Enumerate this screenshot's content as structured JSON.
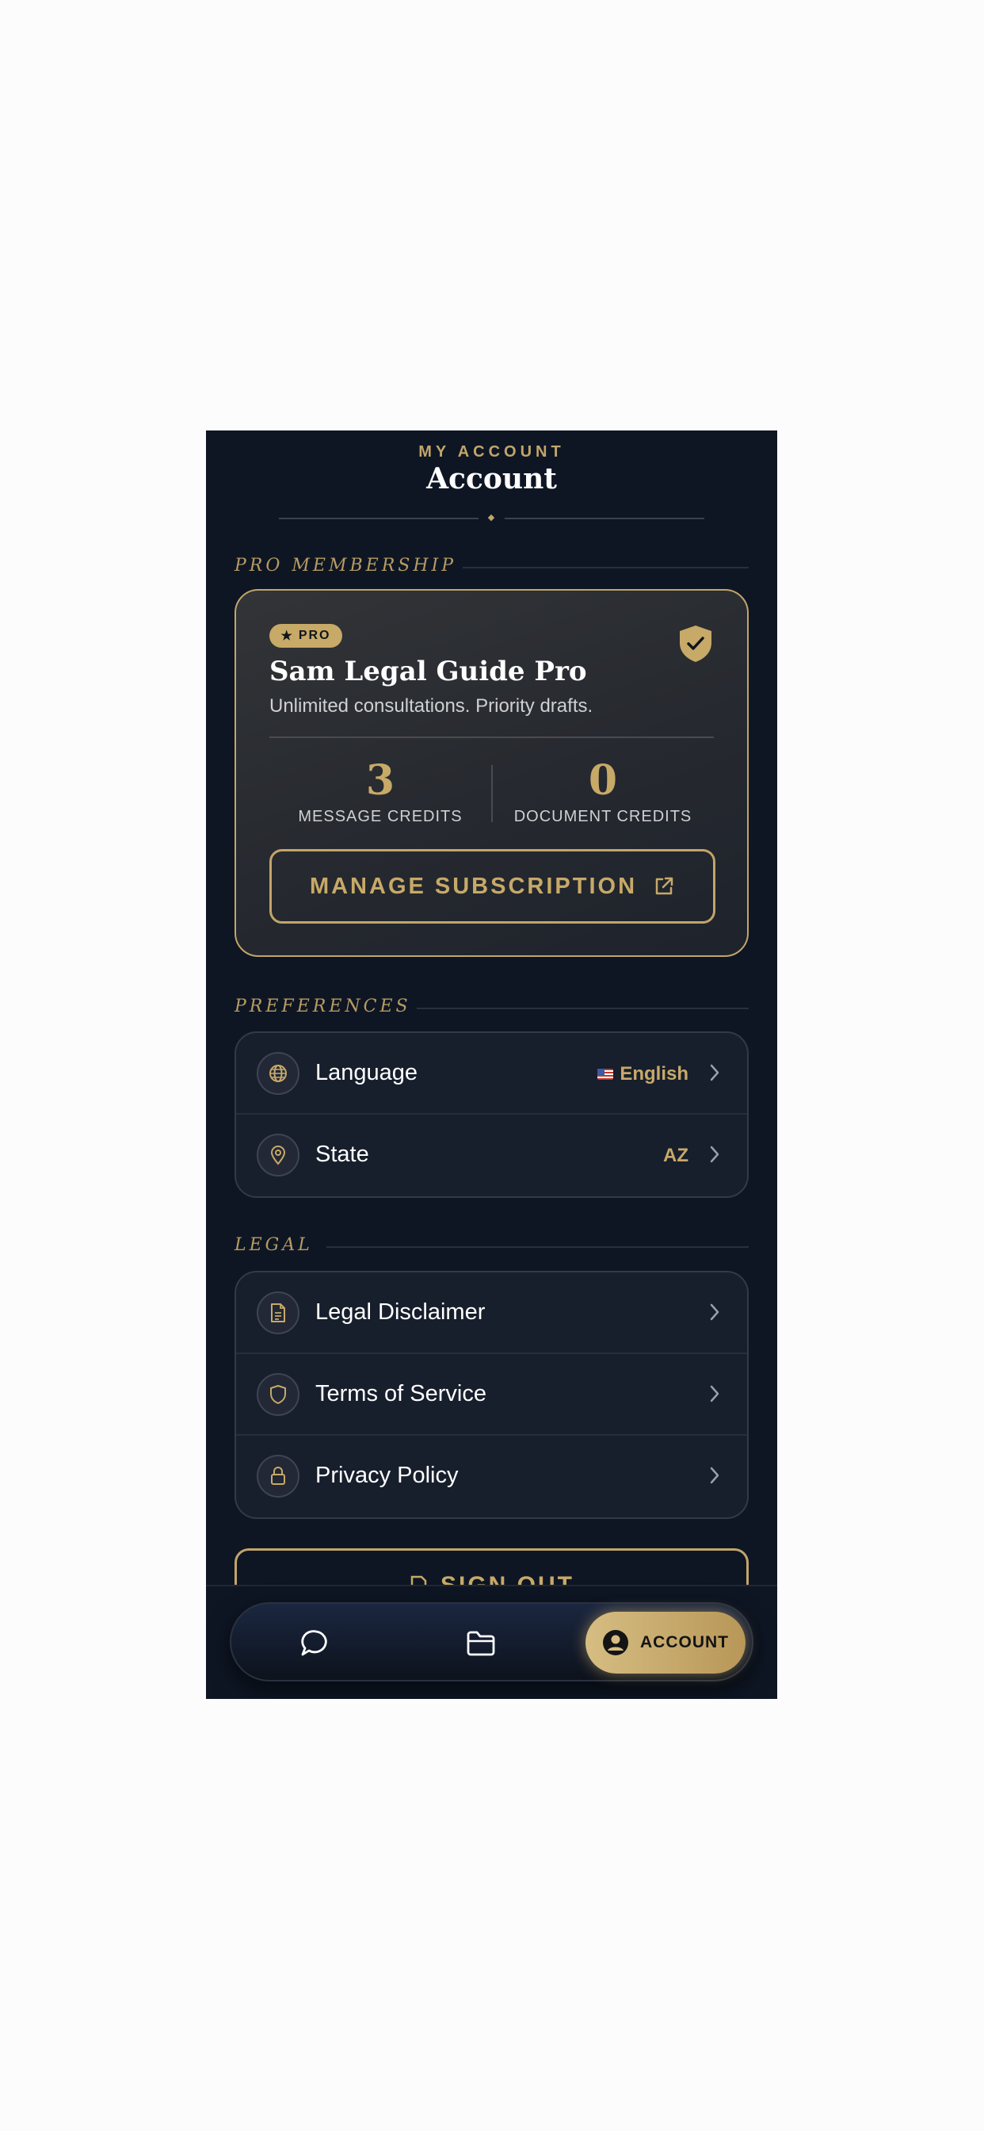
{
  "header": {
    "eyebrow": "MY ACCOUNT",
    "title": "Account"
  },
  "sections": {
    "membership": "PRO MEMBERSHIP",
    "preferences": "PREFERENCES",
    "legal": "LEGAL"
  },
  "pro_card": {
    "badge": "PRO",
    "plan_name": "Sam Legal Guide Pro",
    "plan_desc": "Unlimited consultations. Priority drafts.",
    "message_credits": "3",
    "message_credits_label": "MESSAGE CREDITS",
    "document_credits": "0",
    "document_credits_label": "DOCUMENT CREDITS",
    "manage_label": "MANAGE SUBSCRIPTION"
  },
  "preferences": [
    {
      "label": "Language",
      "value": "English",
      "icon": "globe-icon"
    },
    {
      "label": "State",
      "value": "AZ",
      "icon": "map-pin-icon"
    }
  ],
  "legal": [
    {
      "label": "Legal Disclaimer",
      "icon": "document-icon"
    },
    {
      "label": "Terms of Service",
      "icon": "shield-icon"
    },
    {
      "label": "Privacy Policy",
      "icon": "lock-icon"
    }
  ],
  "sign_out_label": "SIGN OUT",
  "nav": {
    "account_label": "ACCOUNT"
  },
  "colors": {
    "gold": "#c7a968",
    "background": "#0e1624",
    "card": "#171e2c"
  }
}
